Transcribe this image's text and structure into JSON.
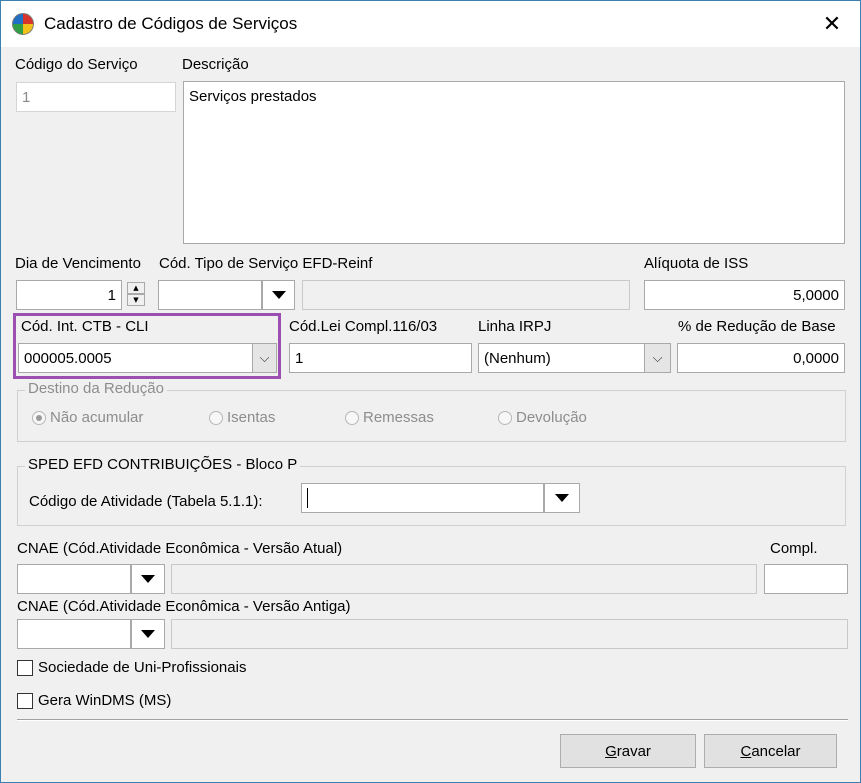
{
  "window": {
    "title": "Cadastro de Códigos de Serviços",
    "close_glyph": "✕"
  },
  "labels": {
    "codigo_servico": "Código do Serviço",
    "descricao": "Descrição",
    "dia_vencimento": "Dia de Vencimento",
    "tipo_servico_reinf": "Cód. Tipo de Serviço EFD-Reinf",
    "aliquota_iss": "Alíquota de ISS",
    "cod_int_ctb": "Cód. Int. CTB - CLI",
    "cod_lei": "Cód.Lei Compl.116/03",
    "linha_irpj": "Linha IRPJ",
    "reducao_base": "% de Redução de Base",
    "cnae_atual": "CNAE (Cód.Atividade Econômica - Versão Atual)",
    "compl": "Compl.",
    "cnae_antiga": "CNAE (Cód.Atividade Econômica - Versão Antiga)"
  },
  "values": {
    "codigo_servico": "1",
    "descricao": "Serviços prestados",
    "dia_vencimento": "1",
    "aliquota_iss": "5,0000",
    "cod_int_ctb": "000005.0005",
    "cod_lei": "1",
    "linha_irpj": "(Nenhum)",
    "reducao_base": "0,0000"
  },
  "destino_reducao": {
    "legend": "Destino da Redução",
    "options": [
      "Não acumular",
      "Isentas",
      "Remessas",
      "Devolução"
    ],
    "selected": "Não acumular"
  },
  "sped": {
    "legend": "SPED EFD CONTRIBUIÇÕES - Bloco P",
    "codigo_atividade_label": "Código de Atividade (Tabela 5.1.1):"
  },
  "checkboxes": {
    "uni_profissionais": "Sociedade de Uni-Profissionais",
    "gera_windms": "Gera WinDMS (MS)"
  },
  "buttons": {
    "gravar_first": "G",
    "gravar_rest": "ravar",
    "cancelar_first": "C",
    "cancelar_rest": "ancelar"
  },
  "icons": {
    "app": "wheel-app-icon",
    "close": "close-icon",
    "dropdown": "triangle-down-icon",
    "combo": "chevron-down-icon",
    "spin": "spin-up-down-icon"
  },
  "colors": {
    "highlight": "#9b4fb0",
    "window_border": "#3c7fb1"
  }
}
